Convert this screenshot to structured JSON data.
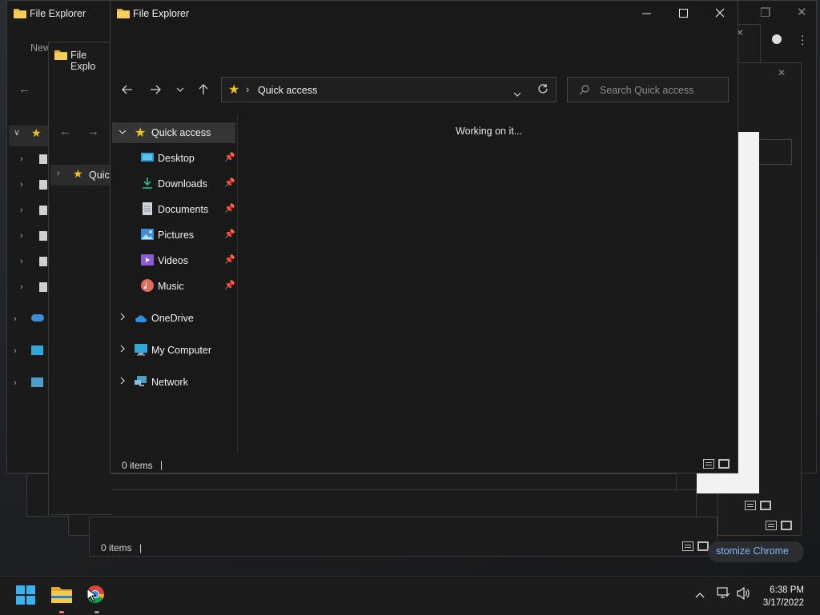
{
  "windows": {
    "main_title": "File Explorer",
    "bg_title_1": "File Explorer",
    "bg_title_2": "File Explo",
    "bg_toolbar_new": "New",
    "bg_nav_quick": "Quic",
    "bg_status": "0 items",
    "chrome_customize": "stomize Chrome"
  },
  "address": {
    "location": "Quick access",
    "search_placeholder": "Search Quick access"
  },
  "nav": {
    "quick_access": "Quick access",
    "items": [
      {
        "label": "Desktop",
        "icon": "desktop-icon"
      },
      {
        "label": "Downloads",
        "icon": "downloads-icon"
      },
      {
        "label": "Documents",
        "icon": "documents-icon"
      },
      {
        "label": "Pictures",
        "icon": "pictures-icon"
      },
      {
        "label": "Videos",
        "icon": "videos-icon"
      },
      {
        "label": "Music",
        "icon": "music-icon"
      }
    ],
    "onedrive": "OneDrive",
    "my_computer": "My Computer",
    "network": "Network"
  },
  "content": {
    "status_message": "Working on it..."
  },
  "status": {
    "items": "0 items"
  },
  "taskbar": {
    "time": "6:38 PM",
    "date": "3/17/2022"
  },
  "colors": {
    "accent_yellow": "#f4c21b",
    "selection": "#353535",
    "background": "#191919"
  }
}
